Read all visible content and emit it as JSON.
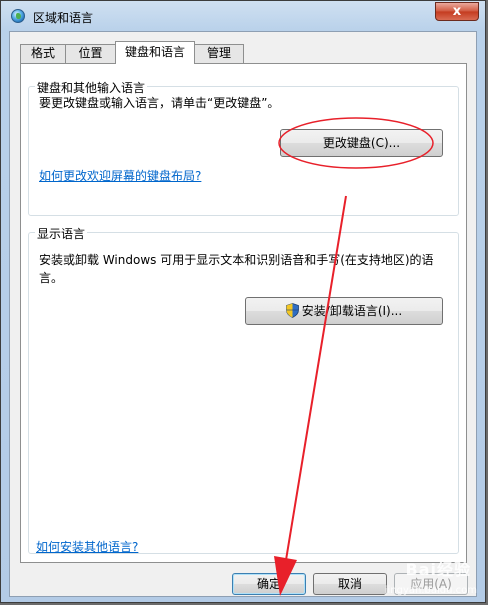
{
  "window": {
    "title": "区域和语言",
    "close_label": "x"
  },
  "tabs": [
    {
      "label": "格式"
    },
    {
      "label": "位置"
    },
    {
      "label": "键盘和语言",
      "active": true
    },
    {
      "label": "管理"
    }
  ],
  "keyboard_group": {
    "legend": "键盘和其他输入语言",
    "description": "要更改键盘或输入语言，请单击“更改键盘”。",
    "change_button": "更改键盘(C)...",
    "welcome_link": "如何更改欢迎屏幕的键盘布局?"
  },
  "display_group": {
    "legend": "显示语言",
    "description_line1": "安装或卸载 Windows 可用于显示文本和识别语音和手写(在支持地区)的语",
    "description_line2": "言。",
    "install_button": "安装/卸载语言(I)..."
  },
  "footer": {
    "more_languages_link": "如何安装其他语言?",
    "ok_button": "确定",
    "cancel_button": "取消",
    "apply_button": "应用(A)"
  },
  "watermark": {
    "brand": "Bai经验",
    "url": "jingyan.baidu.com"
  },
  "colors": {
    "annotation_red": "#e8202a",
    "link_blue": "#0066cc"
  }
}
